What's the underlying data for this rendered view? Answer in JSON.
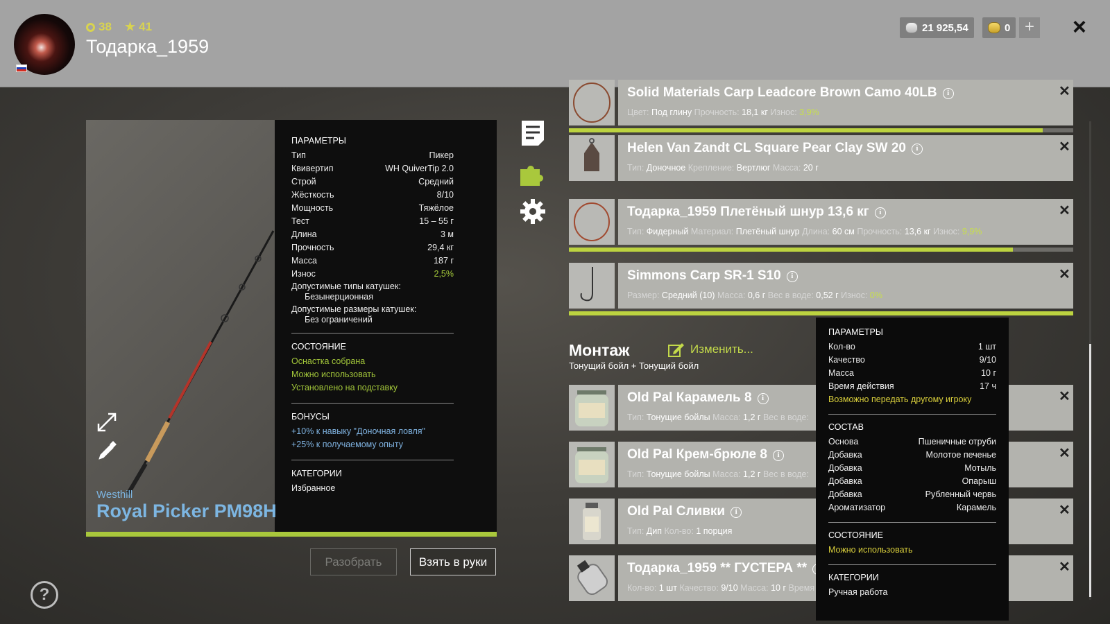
{
  "header": {
    "level": "38",
    "rank": "41",
    "username": "Тодарка_1959",
    "silver": "21 925,54",
    "gold": "0",
    "plus_label": "+",
    "close_label": "×"
  },
  "rod": {
    "brand": "Westhill",
    "name": "Royal Picker PM98H",
    "condition_fraction": 1.0,
    "params_title": "ПАРАМЕТРЫ",
    "params": [
      {
        "k": "Тип",
        "v": "Пикер"
      },
      {
        "k": "Квивертип",
        "v": "WH QuiverTip 2.0"
      },
      {
        "k": "Строй",
        "v": "Средний"
      },
      {
        "k": "Жёсткость",
        "v": "8/10"
      },
      {
        "k": "Мощность",
        "v": "Тяжёлое"
      },
      {
        "k": "Тест",
        "v": "15 – 55 г"
      },
      {
        "k": "Длина",
        "v": "3 м"
      },
      {
        "k": "Прочность",
        "v": "29,4 кг"
      },
      {
        "k": "Масса",
        "v": "187 г"
      },
      {
        "k": "Износ",
        "v": "2,5%"
      }
    ],
    "reel_types_label": "Допустимые типы катушек:",
    "reel_types_value": "Безынерционная",
    "reel_sizes_label": "Допустимые размеры катушек:",
    "reel_sizes_value": "Без ограничений",
    "state_title": "СОСТОЯНИЕ",
    "state": [
      "Оснастка собрана",
      "Можно использовать",
      "Установлено на подставку"
    ],
    "bonus_title": "БОНУСЫ",
    "bonuses": [
      "+10% к навыку \"Доночная ловля\"",
      "+25% к получаемому опыту"
    ],
    "cat_title": "КАТЕГОРИИ",
    "category": "Избранное",
    "btn_disassemble": "Разобрать",
    "btn_take": "Взять в руки"
  },
  "items": [
    {
      "title": "Solid Materials Carp Leadcore Brown Camo 40LB",
      "props": [
        [
          "Цвет:",
          "Под глину"
        ],
        [
          "Прочность:",
          "18,1 кг"
        ],
        [
          "Износ:",
          "3,9%"
        ]
      ],
      "wear_fraction": 0.94
    },
    {
      "title": "Helen Van Zandt CL Square Pear Clay SW 20",
      "props": [
        [
          "Тип:",
          "Доночное"
        ],
        [
          "Крепление:",
          "Вертлюг"
        ],
        [
          "Масса:",
          "20 г"
        ]
      ]
    },
    {
      "title": "Тодарка_1959 Плетёный шнур 13,6 кг",
      "props": [
        [
          "Тип:",
          "Фидерный"
        ],
        [
          "Материал:",
          "Плетёный шнур"
        ],
        [
          "Длина:",
          "60 см"
        ],
        [
          "Прочность:",
          "13,6 кг"
        ],
        [
          "Износ:",
          "9,9%"
        ]
      ],
      "wear_fraction": 0.88
    },
    {
      "title": "Simmons Carp SR-1 S10",
      "props": [
        [
          "Размер:",
          "Средний (10)"
        ],
        [
          "Масса:",
          "0,6 г"
        ],
        [
          "Вес в воде:",
          "0,52 г"
        ],
        [
          "Износ:",
          "0%"
        ]
      ],
      "wear_fraction": 1.0
    }
  ],
  "montage": {
    "title": "Монтаж",
    "subtitle": "Тонущий бойл  +  Тонущий бойл",
    "edit_label": "Изменить..."
  },
  "baits": [
    {
      "title": "Old Pal Карамель 8",
      "props": [
        [
          "Тип:",
          "Тонущие бойлы"
        ],
        [
          "Масса:",
          "1,2 г"
        ],
        [
          "Вес в воде:",
          ""
        ]
      ]
    },
    {
      "title": "Old Pal Крем-брюле 8",
      "props": [
        [
          "Тип:",
          "Тонущие бойлы"
        ],
        [
          "Масса:",
          "1,2 г"
        ],
        [
          "Вес в воде:",
          ""
        ]
      ]
    },
    {
      "title": "Old Pal Сливки",
      "props": [
        [
          "Тип:",
          "Дип"
        ],
        [
          "Кол-во:",
          "1 порция"
        ]
      ]
    },
    {
      "title": "Тодарка_1959 ** ГУСТЕРА **",
      "props": [
        [
          "Кол-во:",
          "1 шт"
        ],
        [
          "Качество:",
          "9/10"
        ],
        [
          "Масса:",
          "10 г"
        ],
        [
          "Время",
          ""
        ]
      ]
    }
  ],
  "tooltip": {
    "params_title": "ПАРАМЕТРЫ",
    "params": [
      {
        "k": "Кол-во",
        "v": "1 шт"
      },
      {
        "k": "Качество",
        "v": "9/10"
      },
      {
        "k": "Масса",
        "v": "10 г"
      },
      {
        "k": "Время действия",
        "v": "17 ч"
      }
    ],
    "transfer_note": "Возможно передать другому игроку",
    "comp_title": "СОСТАВ",
    "composition": [
      {
        "k": "Основа",
        "v": "Пшеничные отруби"
      },
      {
        "k": "Добавка",
        "v": "Молотое печенье"
      },
      {
        "k": "Добавка",
        "v": "Мотыль"
      },
      {
        "k": "Добавка",
        "v": "Опарыш"
      },
      {
        "k": "Добавка",
        "v": "Рубленный червь"
      },
      {
        "k": "Ароматизатор",
        "v": "Карамель"
      }
    ],
    "state_title": "СОСТОЯНИЕ",
    "state": "Можно использовать",
    "cat_title": "КАТЕГОРИИ",
    "category": "Ручная работа"
  },
  "help_label": "?",
  "icons": {
    "side": [
      "document-icon",
      "puzzle-icon",
      "gear-icon"
    ],
    "rod": [
      "expand-icon",
      "edit-icon"
    ]
  },
  "colors": {
    "accent_green": "#a3c73a",
    "bonus_blue": "#7fb2e0",
    "rod_name_blue": "#7db6e2",
    "tooltip_yellow": "#d9cf3c"
  }
}
